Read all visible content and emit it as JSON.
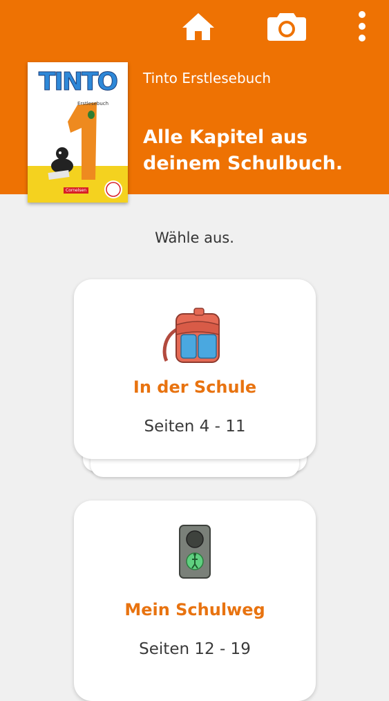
{
  "toolbar": {
    "home_icon": "home-icon",
    "camera_icon": "camera-icon",
    "menu_icon": "more-vertical-icon"
  },
  "book": {
    "cover_title": "TINTO",
    "cover_subtitle": "Erstlesebuch",
    "cover_publisher": "Cornelsen",
    "name": "Tinto Erstlesebuch",
    "headline": "Alle Kapitel aus deinem Schulbuch."
  },
  "prompt": "Wähle aus.",
  "chapters": [
    {
      "title": "In der Schule",
      "pages": "Seiten 4 - 11",
      "icon": "backpack-icon"
    },
    {
      "title": "Mein Schulweg",
      "pages": "Seiten 12 - 19",
      "icon": "traffic-light-icon"
    }
  ],
  "colors": {
    "accent": "#ee7203",
    "chapter_title": "#e87310",
    "background": "#f0f0f0"
  }
}
